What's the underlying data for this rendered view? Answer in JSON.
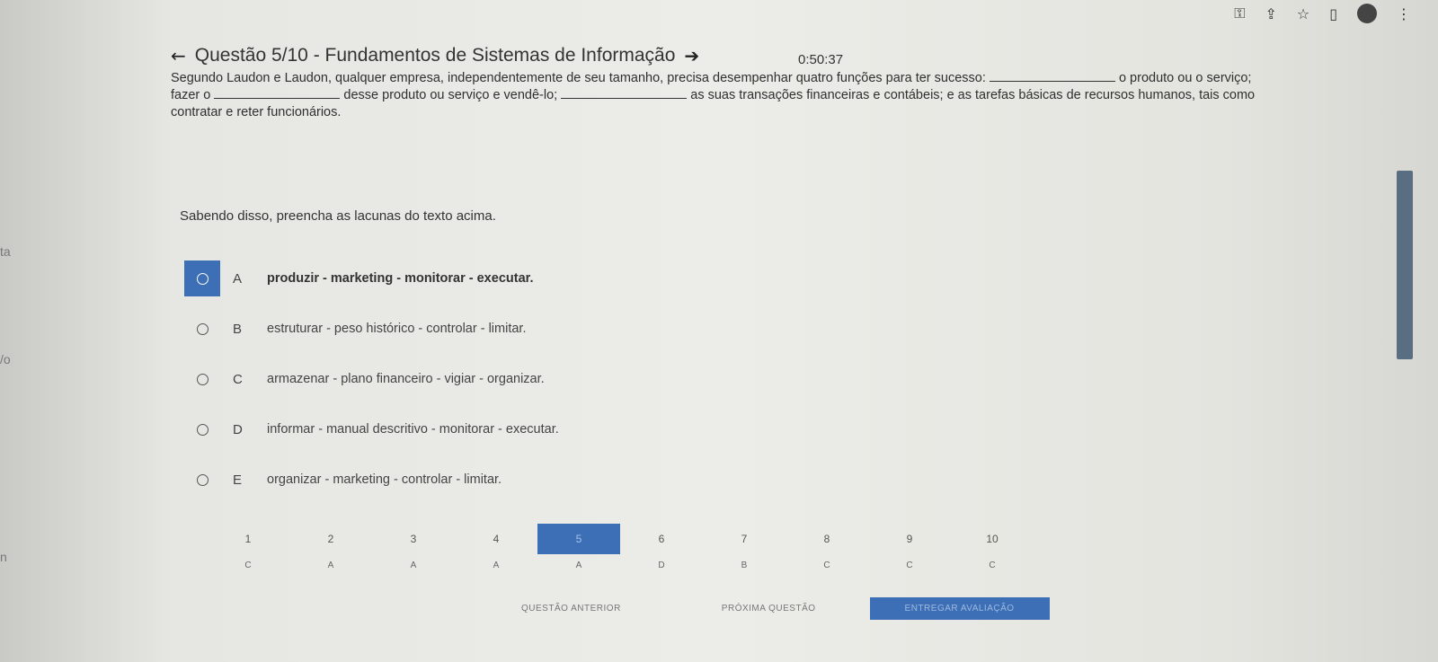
{
  "browser": {
    "icons": [
      "key-icon",
      "share-icon",
      "star-icon",
      "tab-icon",
      "avatar-icon",
      "menu-icon"
    ]
  },
  "left_edge": [
    "ta",
    "/o",
    "n"
  ],
  "timer": "0:50:37",
  "question": {
    "title": "Questão 5/10 - Fundamentos de Sistemas de Informação",
    "text_line1": "Segundo Laudon e Laudon, qualquer empresa, independentemente de seu tamanho, precisa desempenhar quatro funções para ter sucesso:",
    "text_after_blank1": "o produto ou o serviço;",
    "text_fazer": "fazer o",
    "text_after_blank2": "desse produto ou serviço e vendê-lo;",
    "text_after_blank3": "as suas transações financeiras e contábeis; e as tarefas básicas de recursos humanos, tais como",
    "text_end": "contratar e reter funcionários.",
    "prompt": "Sabendo disso, preencha as lacunas do texto acima."
  },
  "options": [
    {
      "letter": "A",
      "text": "produzir - marketing - monitorar - executar.",
      "selected": true
    },
    {
      "letter": "B",
      "text": "estruturar - peso histórico - controlar - limitar.",
      "selected": false
    },
    {
      "letter": "C",
      "text": "armazenar - plano financeiro - vigiar - organizar.",
      "selected": false
    },
    {
      "letter": "D",
      "text": "informar - manual descritivo - monitorar - executar.",
      "selected": false
    },
    {
      "letter": "E",
      "text": "organizar - marketing - controlar - limitar.",
      "selected": false
    }
  ],
  "navigation": {
    "numbers": [
      "1",
      "2",
      "3",
      "4",
      "5",
      "6",
      "7",
      "8",
      "9",
      "10"
    ],
    "answers": [
      "C",
      "A",
      "A",
      "A",
      "A",
      "D",
      "B",
      "C",
      "C",
      "C"
    ],
    "current": 5
  },
  "footer": {
    "prev_label": "QUESTÃO ANTERIOR",
    "next_label": "PRÓXIMA QUESTÃO",
    "submit_label": "ENTREGAR AVALIAÇÃO"
  },
  "colors": {
    "accent": "#3c6fb6",
    "background": "#ececE8"
  }
}
